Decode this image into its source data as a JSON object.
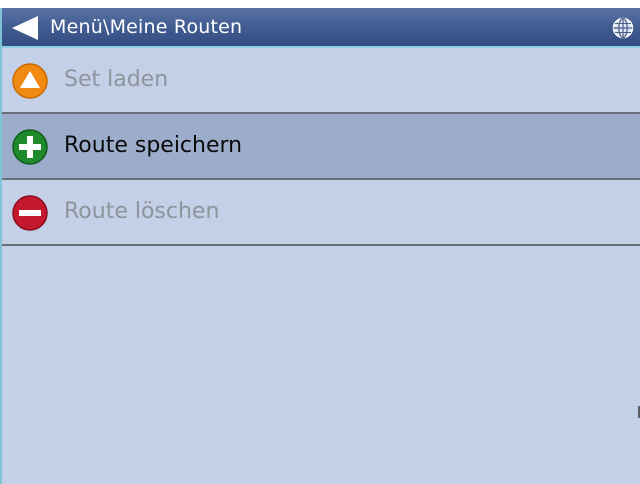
{
  "header": {
    "title": "Menü\\Meine Routen",
    "back_icon": "back-arrow-icon",
    "globe_icon": "globe-icon"
  },
  "menu": {
    "items": [
      {
        "label": "Set laden",
        "icon": "warning-triangle-icon",
        "state": "disabled",
        "icon_color": "#f08a12"
      },
      {
        "label": "Route speichern",
        "icon": "plus-icon",
        "state": "enabled",
        "icon_color": "#1e8a2c"
      },
      {
        "label": "Route löschen",
        "icon": "minus-icon",
        "state": "disabled",
        "icon_color": "#c4182e"
      }
    ]
  },
  "colors": {
    "header_bg": "#3f5a8f",
    "content_bg": "#c3d0e8",
    "selected_row_bg": "#9cadcc",
    "accent_line": "#8fd0e3"
  }
}
